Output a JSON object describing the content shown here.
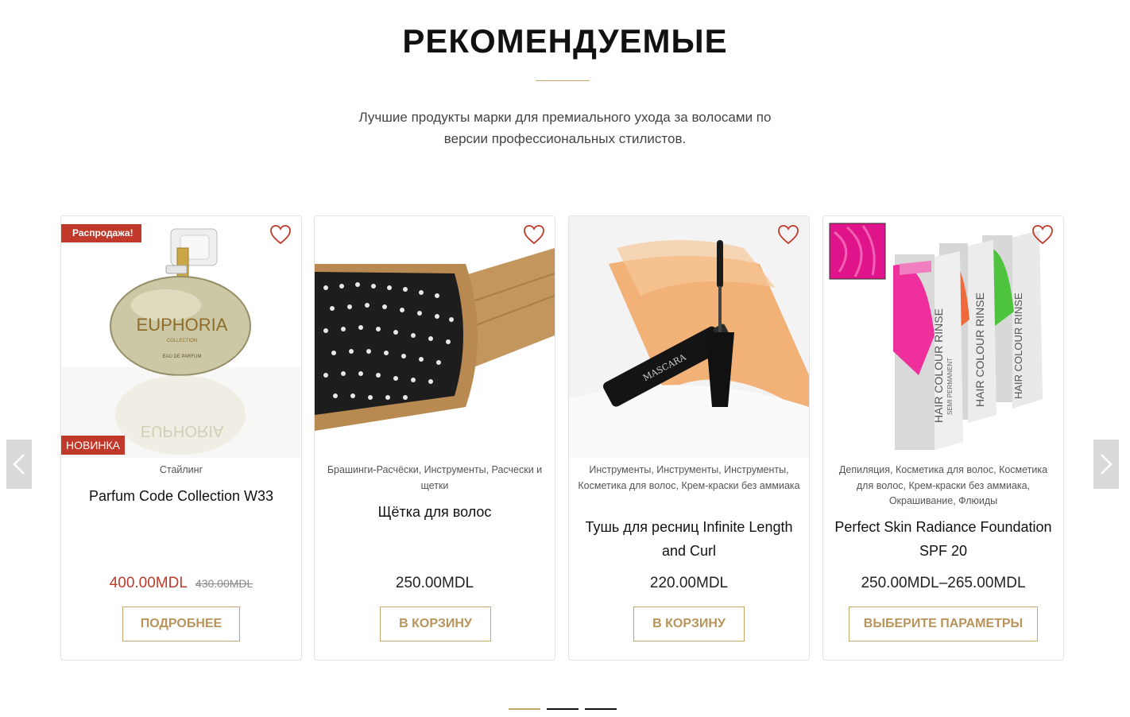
{
  "section": {
    "title": "РЕКОМЕНДУЕМЫЕ",
    "subtitle_line1": "Лучшие продукты марки для премиального ухода за волосами по",
    "subtitle_line2": "версии профессиональных стилистов."
  },
  "colors": {
    "accent_gold": "#c4a56a",
    "sale_red": "#c0392b",
    "text_dark": "#111111"
  },
  "products": [
    {
      "sale_badge": "Распродажа!",
      "new_badge": "НОВИНКА",
      "categories": "Стайлинг",
      "name": "Parfum Code Collection W33",
      "price": "400.00MDL",
      "old_price": "430.00MDL",
      "button": "ПОДРОБНЕЕ",
      "bottle_text": "EUPHORIA",
      "bottle_subtext": "COLLECTION",
      "bottle_subtext2": "EAU DE PARFUM"
    },
    {
      "categories": "Брашинги-Расчёски, Инструменты, Расчески и щетки",
      "name": "Щётка для волос",
      "price": "250.00MDL",
      "button": "В КОРЗИНУ"
    },
    {
      "categories": "Инструменты, Инструменты, Инструменты, Косметика для волос, Крем-краски без аммиака",
      "name": "Тушь для ресниц Infinite Length and Curl",
      "price": "220.00MDL",
      "button": "В КОРЗИНУ",
      "tube_text": "MASCARA"
    },
    {
      "categories": "Депиляция, Косметика для волос, Косметика для волос, Крем-краски без аммиака, Окрашивание, Флюиды",
      "name": "Perfect Skin Radiance Foundation SPF 20",
      "price": "250.00MDL–265.00MDL",
      "button": "ВЫБЕРИТЕ ПАРАМЕТРЫ",
      "box_text": "HAIR COLOUR RINSE",
      "box_subtext": "SEMI PERMANENT"
    }
  ],
  "slider": {
    "prev_icon": "chevron-left-icon",
    "next_icon": "chevron-right-icon",
    "pages": 3,
    "active_page": 1
  }
}
